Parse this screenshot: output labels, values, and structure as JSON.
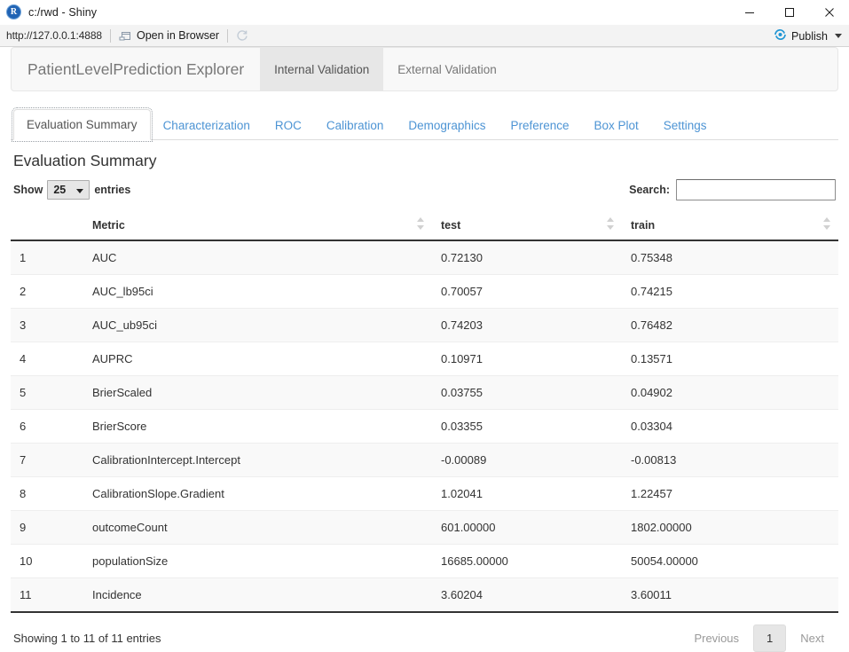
{
  "window": {
    "title": "c:/rwd - Shiny",
    "app_icon": "r-logo-icon",
    "minimize_label": "minimize-icon",
    "maximize_label": "maximize-icon",
    "close_label": "close-icon"
  },
  "viewer_toolbar": {
    "url": "http://127.0.0.1:4888",
    "open_in_browser": "Open in Browser",
    "refresh_icon": "refresh-icon",
    "publish_label": "Publish"
  },
  "navbar": {
    "brand": "PatientLevelPrediction Explorer",
    "items": [
      {
        "label": "Internal Validation",
        "active": true
      },
      {
        "label": "External Validation",
        "active": false
      }
    ]
  },
  "tabs": [
    {
      "label": "Evaluation Summary",
      "active": true
    },
    {
      "label": "Characterization",
      "active": false
    },
    {
      "label": "ROC",
      "active": false
    },
    {
      "label": "Calibration",
      "active": false
    },
    {
      "label": "Demographics",
      "active": false
    },
    {
      "label": "Preference",
      "active": false
    },
    {
      "label": "Box Plot",
      "active": false
    },
    {
      "label": "Settings",
      "active": false
    }
  ],
  "panel": {
    "title": "Evaluation Summary"
  },
  "table_controls": {
    "show_label": "Show",
    "entries_label": "entries",
    "page_length": "25",
    "search_label": "Search:",
    "search_value": "",
    "search_placeholder": ""
  },
  "table": {
    "columns": [
      "",
      "Metric",
      "test",
      "train"
    ],
    "rows": [
      {
        "index": "1",
        "metric": "AUC",
        "test": "0.72130",
        "train": "0.75348"
      },
      {
        "index": "2",
        "metric": "AUC_lb95ci",
        "test": "0.70057",
        "train": "0.74215"
      },
      {
        "index": "3",
        "metric": "AUC_ub95ci",
        "test": "0.74203",
        "train": "0.76482"
      },
      {
        "index": "4",
        "metric": "AUPRC",
        "test": "0.10971",
        "train": "0.13571"
      },
      {
        "index": "5",
        "metric": "BrierScaled",
        "test": "0.03755",
        "train": "0.04902"
      },
      {
        "index": "6",
        "metric": "BrierScore",
        "test": "0.03355",
        "train": "0.03304"
      },
      {
        "index": "7",
        "metric": "CalibrationIntercept.Intercept",
        "test": "-0.00089",
        "train": "-0.00813"
      },
      {
        "index": "8",
        "metric": "CalibrationSlope.Gradient",
        "test": "1.02041",
        "train": "1.22457"
      },
      {
        "index": "9",
        "metric": "outcomeCount",
        "test": "601.00000",
        "train": "1802.00000"
      },
      {
        "index": "10",
        "metric": "populationSize",
        "test": "16685.00000",
        "train": "50054.00000"
      },
      {
        "index": "11",
        "metric": "Incidence",
        "test": "3.60204",
        "train": "3.60011"
      }
    ]
  },
  "footer": {
    "info": "Showing 1 to 11 of 11 entries",
    "previous": "Previous",
    "page": "1",
    "next": "Next"
  },
  "colors": {
    "link": "#4d94d4",
    "navbar_bg": "#f8f8f8",
    "navbar_active_bg": "#e7e7e7",
    "row_stripe": "#f9f9f9",
    "publish_icon": "#2196d4"
  }
}
